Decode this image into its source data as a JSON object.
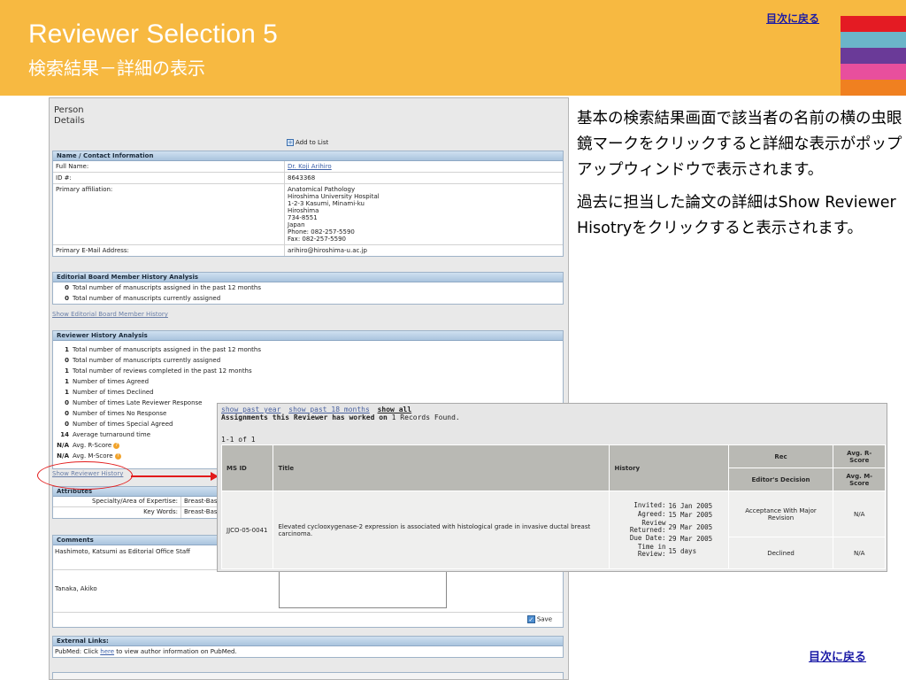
{
  "header": {
    "title": "Reviewer Selection 5",
    "subtitle": "検索結果－詳細の表示",
    "back_link": "目次に戻る",
    "stripe_colors": [
      "#f7b941",
      "#e41b23",
      "#6bb5c9",
      "#6a3a98",
      "#e84f9d",
      "#f08020"
    ]
  },
  "person_page": {
    "heading_line1": "Person",
    "heading_line2": "Details",
    "add_to_list": "Add to List",
    "contact": {
      "title": "Name / Contact Information",
      "rows": [
        {
          "label": "Full Name:",
          "value": "Dr. Koji Arihiro"
        },
        {
          "label": "ID #:",
          "value": "8643368"
        },
        {
          "label": "Primary affiliation:",
          "value": "Anatomical Pathology\nHiroshima University Hospital\n1-2-3 Kasumi, Minami-ku\nHiroshima\n734-8551\nJapan\nPhone: 082-257-5590\nFax: 082-257-5590"
        },
        {
          "label": "Primary E-Mail Address:",
          "value": "arihiro@hiroshima-u.ac.jp"
        }
      ]
    },
    "editorial": {
      "title": "Editorial Board Member History Analysis",
      "lines": [
        {
          "num": "0",
          "text": "Total number of manuscripts assigned in the past 12 months"
        },
        {
          "num": "0",
          "text": "Total number of manuscripts currently assigned"
        }
      ],
      "show_link": "Show Editorial Board Member History"
    },
    "reviewer": {
      "title": "Reviewer History Analysis",
      "lines": [
        {
          "num": "1",
          "text": "Total number of manuscripts assigned in the past 12 months"
        },
        {
          "num": "0",
          "text": "Total number of manuscripts currently assigned"
        },
        {
          "num": "1",
          "text": "Total number of reviews completed in the past 12 months"
        },
        {
          "num": "1",
          "text": "Number of times Agreed"
        },
        {
          "num": "1",
          "text": "Number of times Declined"
        },
        {
          "num": "0",
          "text": "Number of times Late Reviewer Response"
        },
        {
          "num": "0",
          "text": "Number of times No Response"
        },
        {
          "num": "0",
          "text": "Number of times Special Agreed"
        },
        {
          "num": "14",
          "text": "Average turnaround time"
        }
      ],
      "r_score": {
        "num": "N/A",
        "text": "Avg. R-Score"
      },
      "m_score": {
        "num": "N/A",
        "text": "Avg. M-Score"
      },
      "show_link": "Show Reviewer History"
    },
    "attributes": {
      "title": "Attributes",
      "rows": [
        {
          "label": "Specialty/Area of Expertise:",
          "value": "Breast-Basi"
        },
        {
          "label": "Key Words:",
          "value": "Breast-Basi"
        }
      ]
    },
    "comments": {
      "title": "Comments",
      "rows": [
        "Hashimoto, Katsumi as Editorial Office Staff",
        "Tanaka, Akiko"
      ],
      "save_label": "Save"
    },
    "external": {
      "title": "External Links:",
      "text_before": "PubMed: Click ",
      "link_text": "here",
      "text_after": " to view author information on PubMed."
    }
  },
  "popup": {
    "links": [
      "show past year",
      "show past 18 months",
      "show all"
    ],
    "assign_title": "Assignments this Reviewer has worked on",
    "found": "1 Records Found.",
    "range": "1-1 of 1",
    "headers": {
      "ms_id": "MS ID",
      "title": "Title",
      "history": "History",
      "rec": "Rec",
      "r_score": "Avg. R-Score",
      "decision": "Editor's Decision",
      "m_score": "Avg. M-Score"
    },
    "row": {
      "ms_id": "JJCO-05-0041",
      "title": "Elevated cyclooxygenase-2 expression is associated with histological grade in invasive ductal breast carcinoma.",
      "history": [
        {
          "label": "Invited:",
          "value": "16 Jan 2005"
        },
        {
          "label": "Agreed:",
          "value": "15 Mar 2005"
        },
        {
          "label": "Review Returned:",
          "value": "29 Mar 2005"
        },
        {
          "label": "Due Date:",
          "value": "29 Mar 2005"
        },
        {
          "label": "Time in Review:",
          "value": "15 days"
        }
      ],
      "rec": "Acceptance With Major Revision",
      "r_score": "N/A",
      "decision": "Declined",
      "m_score": "N/A"
    }
  },
  "description": {
    "para1": "基本の検索結果画面で該当者の名前の横の虫眼鏡マークをクリックすると詳細な表示がポップアップウィンドウで表示されます。",
    "para2": "過去に担当した論文の詳細はShow Reviewer Hisotryをクリックすると表示されます。"
  },
  "footer": {
    "back_link": "目次に戻る"
  }
}
